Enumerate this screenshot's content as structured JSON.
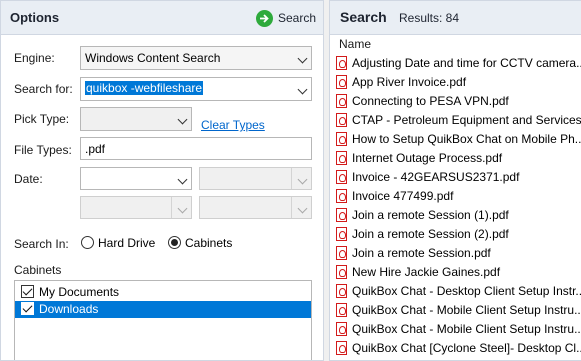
{
  "options": {
    "title": "Options",
    "search_button": "Search",
    "engine_label": "Engine:",
    "engine_value": "Windows Content Search",
    "search_for_label": "Search for:",
    "search_for_value": "quikbox -webfileshare",
    "pick_type_label": "Pick Type:",
    "pick_type_value": "",
    "clear_types": "Clear Types",
    "file_types_label": "File Types:",
    "file_types_value": ".pdf",
    "date_label": "Date:",
    "search_in_label": "Search In:",
    "search_in_options": [
      {
        "label": "Hard Drive",
        "selected": false
      },
      {
        "label": "Cabinets",
        "selected": true
      }
    ],
    "cabinets_label": "Cabinets",
    "cabinets": [
      {
        "label": "My Documents",
        "checked": true,
        "selected": false
      },
      {
        "label": "Downloads",
        "checked": true,
        "selected": true
      }
    ]
  },
  "results": {
    "title": "Search",
    "count_text": "Results: 84",
    "column_name": "Name",
    "items": [
      "Adjusting Date and time for CCTV camera...",
      "App River Invoice.pdf",
      "Connecting to PESA VPN.pdf",
      "CTAP - Petroleum Equipment and Services...",
      "How to Setup QuikBox Chat on Mobile Ph...",
      "Internet Outage Process.pdf",
      "Invoice - 42GEARSUS2371.pdf",
      "Invoice 477499.pdf",
      "Join a remote Session (1).pdf",
      "Join a remote Session (2).pdf",
      "Join a remote Session.pdf",
      "New Hire Jackie Gaines.pdf",
      "QuikBox Chat - Desktop Client Setup Instr...",
      "QuikBox Chat - Mobile Client Setup Instru...",
      "QuikBox Chat - Mobile Client Setup Instru...",
      "QuikBox Chat [Cyclone Steel]- Desktop Cl..."
    ]
  },
  "colors": {
    "accent": "#0078d7",
    "link": "#0066cc",
    "go_icon": "#2eaa3c",
    "pdf_icon": "#d21a1a"
  }
}
